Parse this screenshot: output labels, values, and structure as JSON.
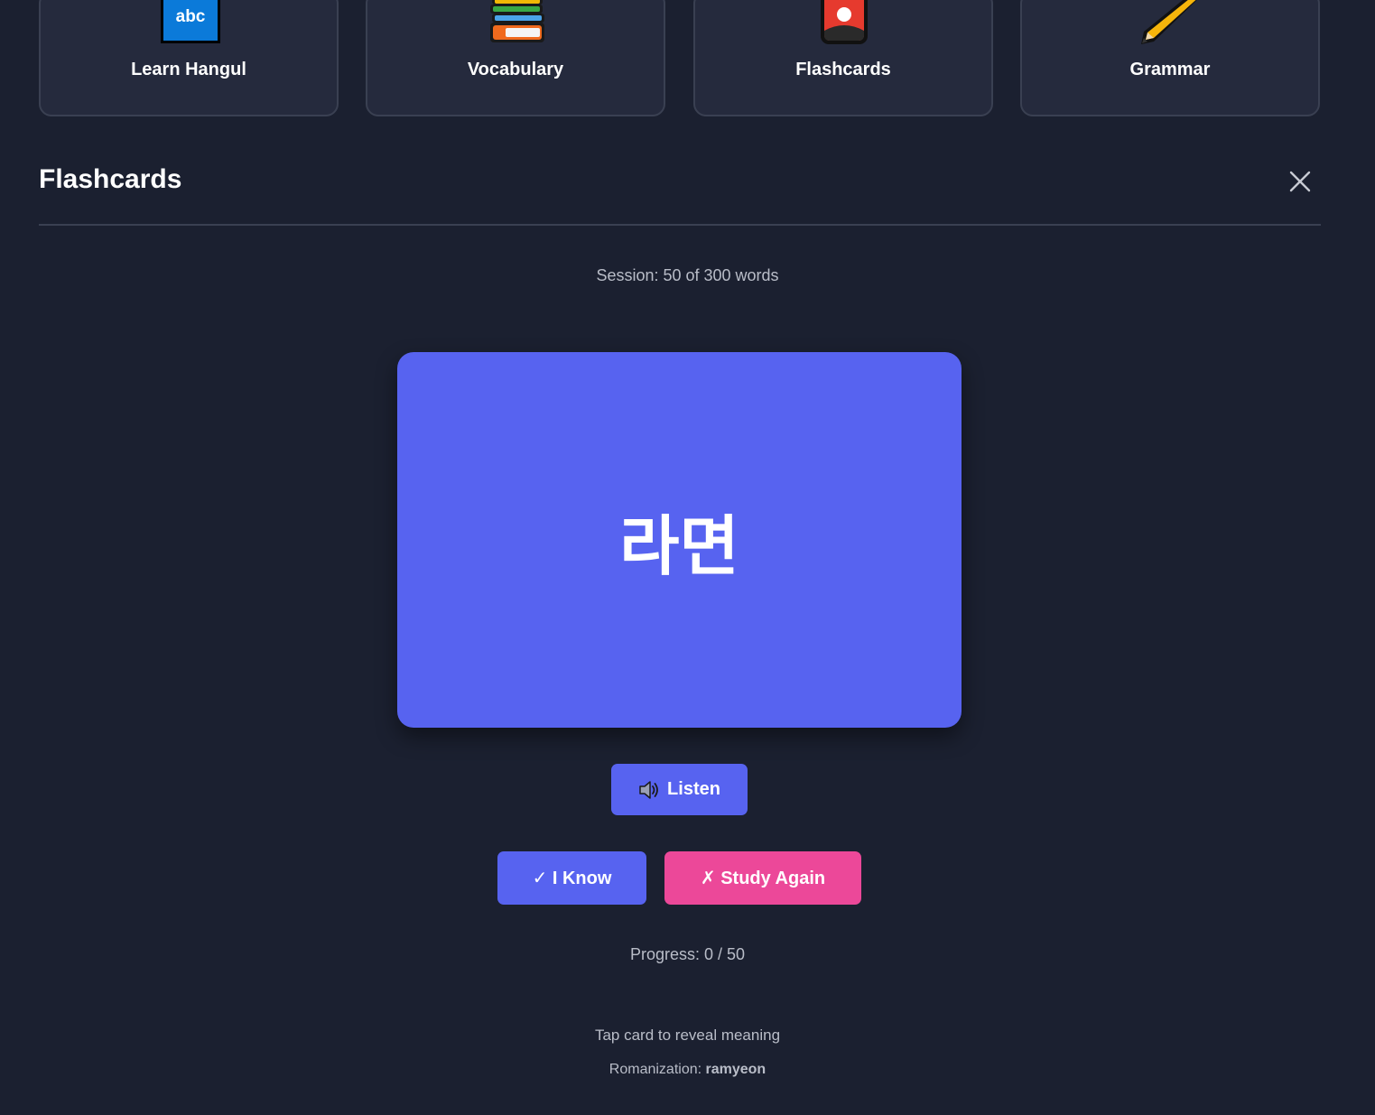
{
  "nav_cards": [
    {
      "label": "Learn Hangul",
      "icon": "abc-icon",
      "icon_text": "abc"
    },
    {
      "label": "Vocabulary",
      "icon": "books-icon"
    },
    {
      "label": "Flashcards",
      "icon": "phone-card-icon"
    },
    {
      "label": "Grammar",
      "icon": "pencil-icon"
    }
  ],
  "section": {
    "title": "Flashcards",
    "close_icon": "close-icon"
  },
  "session": {
    "text": "Session: 50 of 300 words"
  },
  "card": {
    "word": "라면"
  },
  "buttons": {
    "listen_icon": "speaker-icon",
    "listen": "Listen",
    "know": "✓ I Know",
    "study_again": "✗ Study Again"
  },
  "progress": {
    "text": "Progress: 0 / 50",
    "current": 0,
    "total": 50
  },
  "hint": {
    "text": "Tap card to reveal meaning",
    "romanization_label": "Romanization:",
    "romanization_value": "ramyeon"
  },
  "colors": {
    "background": "#1b2030",
    "card_surface": "#252a3d",
    "accent": "#5763f0",
    "danger": "#ec4899",
    "muted_text": "#b9bdc8"
  }
}
